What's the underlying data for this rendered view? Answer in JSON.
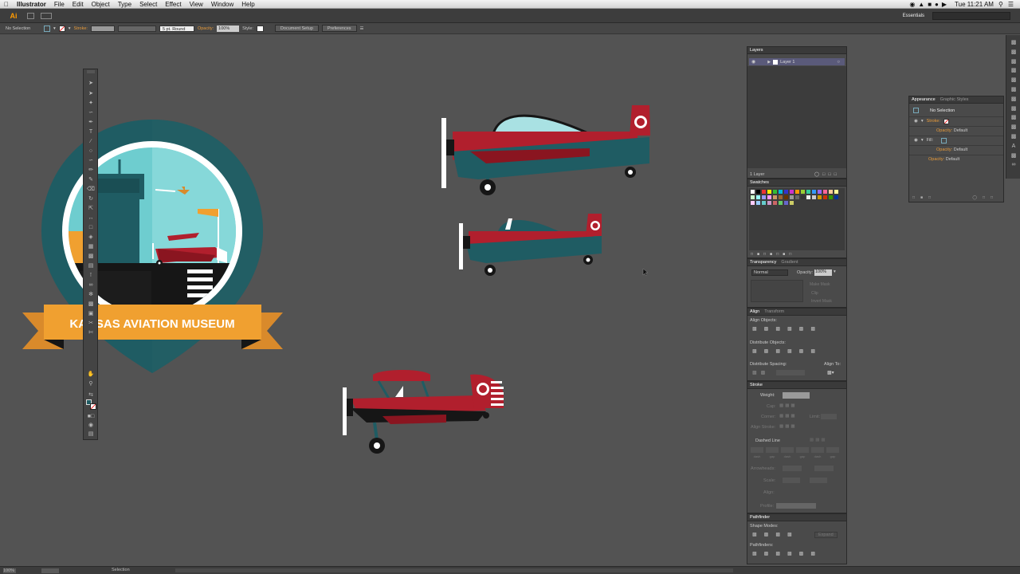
{
  "menubar": {
    "app_name": "Illustrator",
    "items": [
      "File",
      "Edit",
      "Object",
      "Type",
      "Select",
      "Effect",
      "View",
      "Window",
      "Help"
    ],
    "clock": "Tue 11:21 AM"
  },
  "appbar": {
    "logo": "Ai",
    "workspace": "Essentials",
    "search_placeholder": ""
  },
  "controlbar": {
    "selection_label": "No Selection",
    "stroke_label": "Stroke:",
    "brush_value": "5 pt. Round",
    "opacity_label": "Opacity:",
    "opacity_value": "100%",
    "style_label": "Style:",
    "document_setup_button": "Document Setup",
    "preferences_button": "Preferences"
  },
  "artwork": {
    "badge_title": "KANSAS AVIATION MUSEUM",
    "colors": {
      "teal_dark": "#1f5c63",
      "teal_light": "#6ecdcf",
      "red": "#b11f2d",
      "orange": "#f0a030",
      "black": "#161616",
      "white": "#ffffff"
    }
  },
  "layers_panel": {
    "tab": "Layers",
    "layer_name": "Layer 1",
    "footer": "1 Layer"
  },
  "swatches_panel": {
    "tab": "Swatches"
  },
  "transparency_panel": {
    "tabs": [
      "Transparency",
      "Gradient"
    ],
    "blend_mode": "Normal",
    "opacity_label": "Opacity:",
    "opacity_value": "100%",
    "make_mask_button": "Make Mask",
    "clip_label": "Clip",
    "invert_mask_label": "Invert Mask"
  },
  "align_panel": {
    "tabs": [
      "Align",
      "Transform"
    ],
    "align_objects_label": "Align Objects:",
    "distribute_objects_label": "Distribute Objects:",
    "distribute_spacing_label": "Distribute Spacing:",
    "align_to_label": "Align To:"
  },
  "stroke_panel": {
    "tab": "Stroke",
    "weight_label": "Weight:",
    "cap_label": "Cap:",
    "corner_label": "Corner:",
    "limit_label": "Limit:",
    "align_stroke_label": "Align Stroke:",
    "dashed_line_label": "Dashed Line",
    "dash_labels": [
      "dash",
      "gap",
      "dash",
      "gap",
      "dash",
      "gap"
    ],
    "arrowheads_label": "Arrowheads:",
    "scale_label": "Scale:",
    "align_label": "Align:",
    "profile_label": "Profile:"
  },
  "pathfinder_panel": {
    "tab": "Pathfinder",
    "shape_modes_label": "Shape Modes:",
    "expand_button": "Expand",
    "pathfinders_label": "Pathfinders:"
  },
  "appearance_panel": {
    "tabs": [
      "Appearance",
      "Graphic Styles"
    ],
    "title": "No Selection",
    "stroke_label": "Stroke:",
    "fill_label": "Fill:",
    "opacity_label": "Opacity:",
    "opacity_value": "Default"
  },
  "statusbar": {
    "zoom": "100%",
    "tool_name": "Selection"
  }
}
